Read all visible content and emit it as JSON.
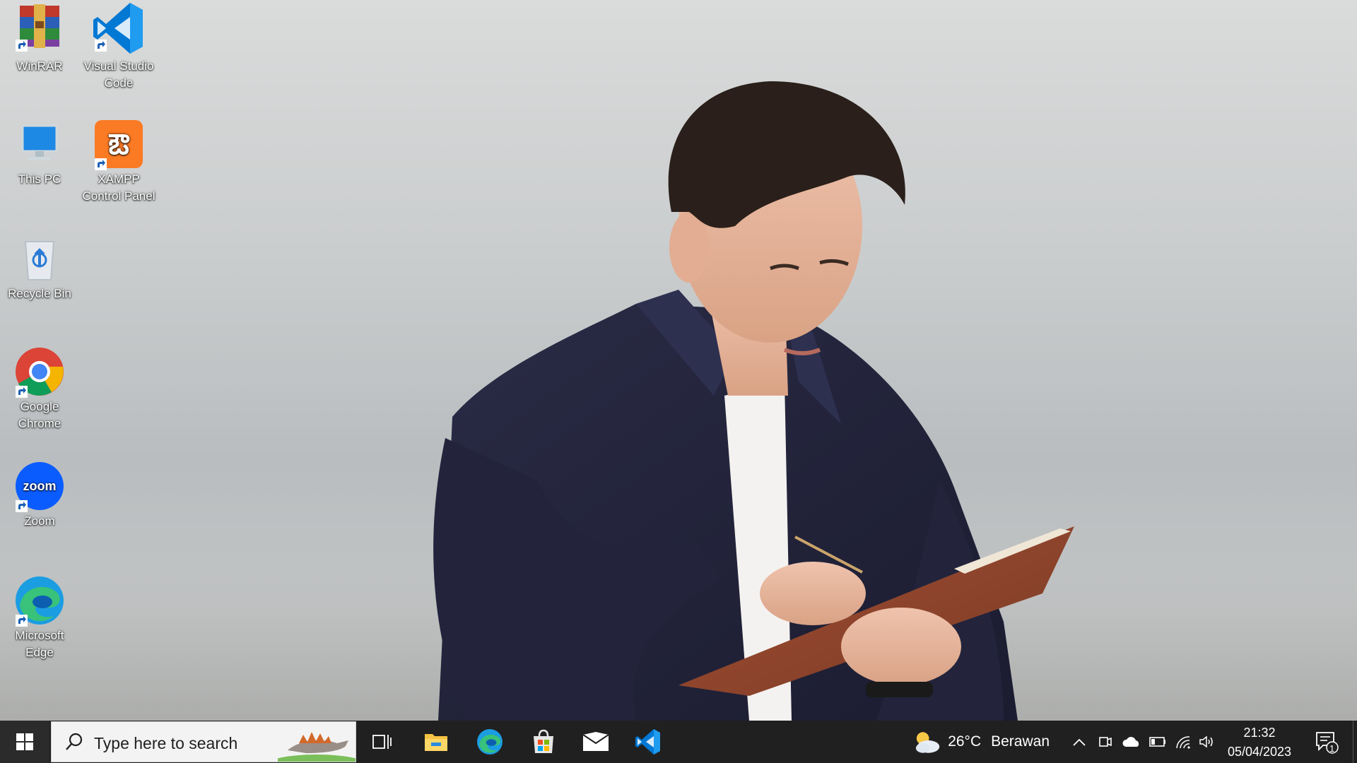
{
  "desktop_icons": [
    {
      "name": "winrar",
      "label": "WinRAR"
    },
    {
      "name": "vscode",
      "label": "Visual Studio Code"
    },
    {
      "name": "this-pc",
      "label": "This PC"
    },
    {
      "name": "xampp",
      "label": "XAMPP Control Panel"
    },
    {
      "name": "recycle-bin",
      "label": "Recycle Bin"
    },
    {
      "name": "chrome",
      "label": "Google Chrome"
    },
    {
      "name": "zoom",
      "label": "Zoom"
    },
    {
      "name": "edge",
      "label": "Microsoft Edge"
    }
  ],
  "taskbar": {
    "search_placeholder": "Type here to search",
    "pinned_icons": [
      "task-view-icon",
      "file-explorer-icon",
      "edge-icon",
      "microsoft-store-icon",
      "mail-icon",
      "vscode-icon"
    ],
    "weather": {
      "temp": "26°C",
      "condition": "Berawan",
      "icon": "partly-cloudy-icon"
    },
    "tray_icons": [
      "show-hidden-icons-chevron",
      "meet-now-icon",
      "onedrive-icon",
      "battery-icon",
      "wifi-icon",
      "volume-icon"
    ],
    "clock": {
      "time": "21:32",
      "date": "05/04/2023"
    },
    "notifications": {
      "count": "1"
    }
  },
  "colors": {
    "taskbar_bg": "#202020",
    "search_bg": "#f3f3f3",
    "vscode_blue": "#0078d4",
    "zoom_blue": "#0b5cff"
  }
}
